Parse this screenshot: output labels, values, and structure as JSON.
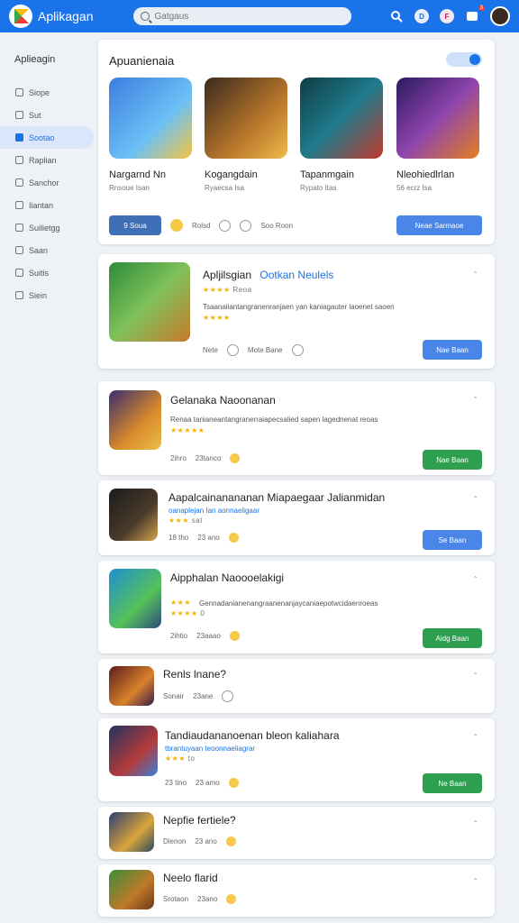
{
  "topbar": {
    "title": "Aplikagan",
    "search_placeholder": "Gatgaus",
    "notif_badge": "3",
    "round_icon_1": "D",
    "round_icon_2": "F"
  },
  "sidebar": {
    "title": "Aplieagin",
    "items": [
      {
        "label": "Siope",
        "icon": "home-icon",
        "active": false
      },
      {
        "label": "Sut",
        "icon": "cart-icon",
        "active": false
      },
      {
        "label": "Sootao",
        "icon": "grid-icon",
        "active": true
      },
      {
        "label": "Raplian",
        "icon": "apps-icon",
        "active": false
      },
      {
        "label": "Sanchor",
        "icon": "list-icon",
        "active": false
      },
      {
        "label": "Iiantan",
        "icon": "list-icon",
        "active": false
      },
      {
        "label": "Suilietgg",
        "icon": "gamepad-icon",
        "active": false
      },
      {
        "label": "Saan",
        "icon": "home-icon",
        "active": false
      },
      {
        "label": "Suitis",
        "icon": "shield-icon",
        "active": false
      },
      {
        "label": "Siein",
        "icon": "doc-icon",
        "active": false
      }
    ]
  },
  "featured": {
    "heading": "Apuanienaia",
    "apps": [
      {
        "name": "Nargarnd Nn",
        "sub": "Rnsoue Isan"
      },
      {
        "name": "Kogangdain",
        "sub": "Ryaecsa Isa"
      },
      {
        "name": "Tapanmgain",
        "sub": "Rypato Itas"
      },
      {
        "name": "Nleohiedlrlan",
        "sub": "56 ecrz Isa"
      }
    ],
    "chip_label": "9 Soua",
    "meta_1": "Rolsd",
    "meta_2": "Soo Roon",
    "button": "Neae Sarmaoe"
  },
  "apps": [
    {
      "title": "Apljilsgian",
      "link": "Ootkan Neulels",
      "stars": "★★★★",
      "stars_text": "Reoa",
      "desc": "Tsaanaiiantangranenranjaen yan kaniagauter laoenet saoen",
      "stars2": "★★★★",
      "meta": [
        "Nete",
        "Mote Bane"
      ],
      "button": "Nae Baan",
      "button_color": "blue"
    },
    {
      "title": "Gelanaka Naoonanan",
      "desc": "Renaa tanianeantangranerraiapecsalied sapen lagednenat reoas",
      "stars": "★★★★★",
      "meta": [
        "2ihro",
        "23tanco"
      ],
      "button": "Nae Baan",
      "button_color": "green"
    },
    {
      "title": "Aapalcainanananan Miapaegaar Jalianmidan",
      "desc": "oanaplejan Ian aonnaeligaar",
      "stars": "★★★",
      "stars_text": "sat",
      "meta": [
        "18 tho",
        "23 ano"
      ],
      "button": "Se Baan",
      "button_color": "blue"
    },
    {
      "title": "Aipphalan Naoooelakigi",
      "stars": "★★★",
      "desc": "Gennadanianenangraanenanjaycaniaepotwcidaenroeas",
      "stars2": "★★★★",
      "stars2_text": "0",
      "meta": [
        "2ihtio",
        "23aaao"
      ],
      "button": "Aidg Baan",
      "button_color": "green"
    },
    {
      "title": "Renls lnane?",
      "meta": [
        "Sonair",
        "23ane"
      ]
    },
    {
      "title": "Tandiaudananoenan bleon kaliahara",
      "desc": "tbrantuyaan teoonnaeliagrar",
      "stars": "★★★",
      "stars_text": "to",
      "meta": [
        "23 tino",
        "23 amo"
      ],
      "button": "Ne Baan",
      "button_color": "green"
    },
    {
      "title": "Nepfie fertiele?",
      "meta": [
        "Dienon",
        "23 ano"
      ]
    },
    {
      "title": "Neelo flarid",
      "meta": [
        "Srotaon",
        "23ano"
      ]
    }
  ],
  "colors": {
    "primary": "#1a73e8",
    "green": "#2e9e4f",
    "star": "#f4b400"
  }
}
